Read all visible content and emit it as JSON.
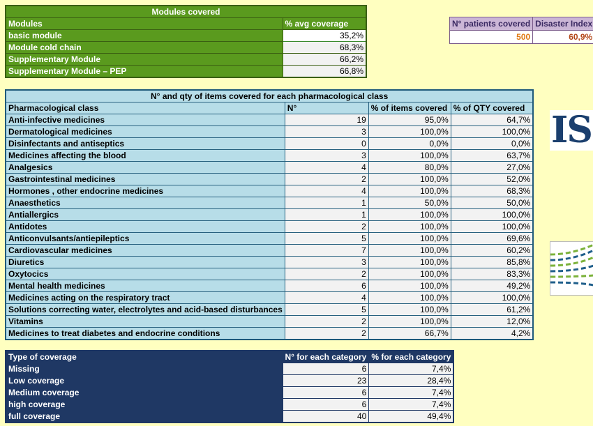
{
  "modules": {
    "title": "Modules covered",
    "headers": [
      "Modules",
      "% avg coverage"
    ],
    "rows": [
      {
        "name": "basic module",
        "value": "35,2%"
      },
      {
        "name": "Module cold chain",
        "value": "68,3%"
      },
      {
        "name": "Supplementary Module",
        "value": "66,2%"
      },
      {
        "name": "Supplementary Module – PEP",
        "value": "66,8%"
      }
    ]
  },
  "patients": {
    "headers": [
      "N° patients covered",
      "Disaster Index"
    ],
    "values": [
      "500",
      "60,9%"
    ],
    "colors": {
      "patients_value": "#e07a12",
      "index_value": "#b4491a"
    }
  },
  "pharma": {
    "title": "N° and qty of items covered for each pharmacological class",
    "headers": [
      "Pharmacological class",
      "N°",
      "% of items covered",
      "% of QTY covered"
    ],
    "rows": [
      [
        "Anti-infective medicines",
        "19",
        "95,0%",
        "64,7%"
      ],
      [
        "Dermatological medicines",
        "3",
        "100,0%",
        "100,0%"
      ],
      [
        "Disinfectants and antiseptics",
        "0",
        "0,0%",
        "0,0%"
      ],
      [
        "Medicines affecting the blood",
        "3",
        "100,0%",
        "63,7%"
      ],
      [
        "Analgesics",
        "4",
        "80,0%",
        "27,0%"
      ],
      [
        "Gastrointestinal medicines",
        "2",
        "100,0%",
        "52,0%"
      ],
      [
        "Hormones , other endocrine medicines",
        "4",
        "100,0%",
        "68,3%"
      ],
      [
        "Anaesthetics",
        "1",
        "50,0%",
        "50,0%"
      ],
      [
        "Antiallergics",
        "1",
        "100,0%",
        "100,0%"
      ],
      [
        "Antidotes",
        "2",
        "100,0%",
        "100,0%"
      ],
      [
        "Anticonvulsants/antiepileptics",
        "5",
        "100,0%",
        "69,6%"
      ],
      [
        "Cardiovascular medicines",
        "7",
        "100,0%",
        "60,2%"
      ],
      [
        "Diuretics",
        "3",
        "100,0%",
        "85,8%"
      ],
      [
        "Oxytocics",
        "2",
        "100,0%",
        "83,3%"
      ],
      [
        "Mental health medicines",
        "6",
        "100,0%",
        "49,2%"
      ],
      [
        "Medicines acting on the respiratory tract",
        "4",
        "100,0%",
        "100,0%"
      ],
      [
        "Solutions correcting water, electrolytes and acid-based disturbances",
        "5",
        "100,0%",
        "61,2%"
      ],
      [
        "Vitamins",
        "2",
        "100,0%",
        "12,0%"
      ],
      [
        "Medicines to treat diabetes and endocrine conditions",
        "2",
        "66,7%",
        "4,2%"
      ]
    ]
  },
  "coverage": {
    "headers": [
      "Type of coverage",
      "N° for each category",
      "% for each category"
    ],
    "rows": [
      [
        "Missing",
        "6",
        "7,4%"
      ],
      [
        "Low coverage",
        "23",
        "28,4%"
      ],
      [
        "Medium coverage",
        "6",
        "7,4%"
      ],
      [
        "high coverage",
        "6",
        "7,4%"
      ],
      [
        "full coverage",
        "40",
        "49,4%"
      ]
    ]
  },
  "logos": {
    "ism_text": "ISM",
    "colors": {
      "ism": "#1b3f6e",
      "stripe_green": "#7bb23a",
      "stripe_blue": "#1f5f8b"
    }
  },
  "colors": {
    "background": "#ffffc0",
    "modules_green": "#5a9a1e",
    "pharma_blue": "#b7dde8",
    "coverage_navy": "#1f3864"
  }
}
